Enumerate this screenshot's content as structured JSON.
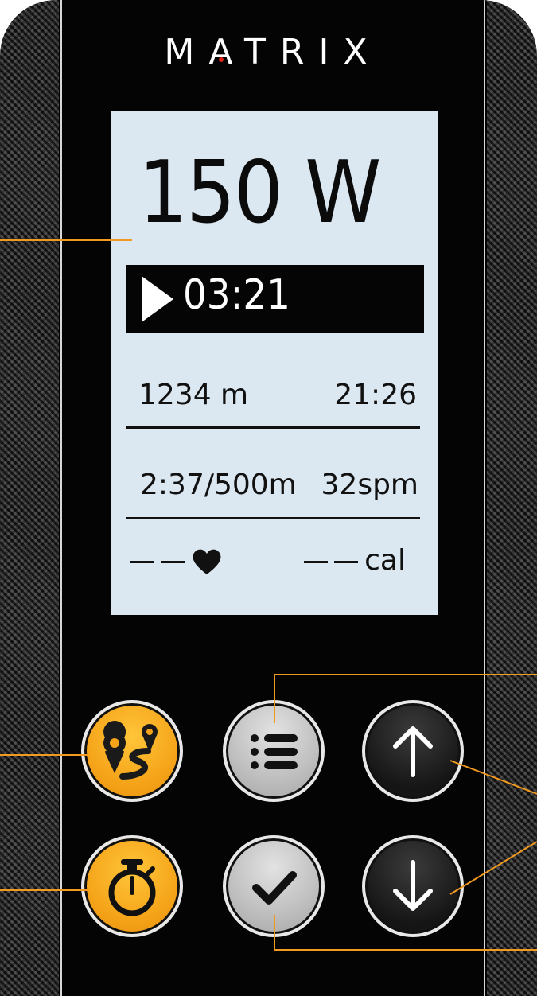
{
  "brand": {
    "name": "MATRIX",
    "accent_color": "#e2231a"
  },
  "display": {
    "watts": "150 W",
    "timer": "03:21",
    "distance": "1234 m",
    "elapsed": "21:26",
    "split": "2:37/500m",
    "stroke_rate": "32spm",
    "heart_rate": "",
    "calories_unit": "cal"
  },
  "buttons": {
    "routes": {
      "icon": "route-pin-icon",
      "color": "#f5a419"
    },
    "workouts_menu": {
      "icon": "list-icon",
      "color": "#bdbdbd"
    },
    "up": {
      "icon": "arrow-up-icon",
      "color": "#151515"
    },
    "timer": {
      "icon": "stopwatch-icon",
      "color": "#f5a419"
    },
    "confirm": {
      "icon": "checkmark-icon",
      "color": "#bdbdbd"
    },
    "down": {
      "icon": "arrow-down-icon",
      "color": "#151515"
    }
  },
  "callout_color": "#f29a1f"
}
